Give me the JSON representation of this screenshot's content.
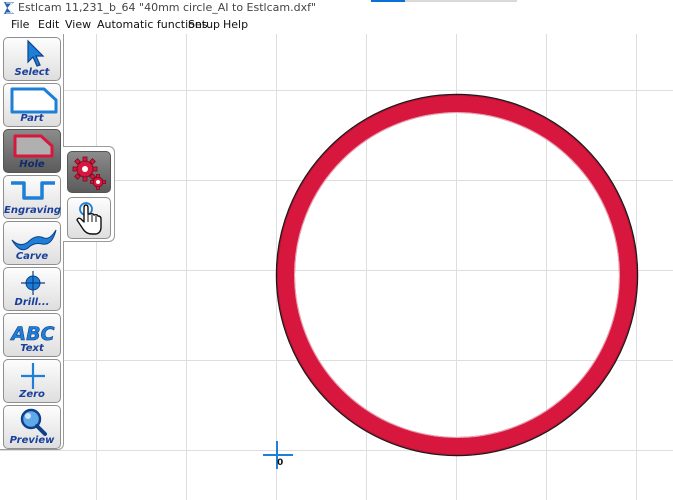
{
  "window": {
    "title": "Estlcam 11,231_b_64 \"40mm circle_AI to Estlcam.dxf\""
  },
  "menu": {
    "items": [
      "File",
      "Edit",
      "View",
      "Automatic functions",
      "Setup",
      "Help"
    ]
  },
  "toolbar": {
    "select": "Select",
    "part": "Part",
    "hole": "Hole",
    "engraving": "Engraving",
    "carve": "Carve",
    "drill": "Drill...",
    "text": "Text",
    "zero": "Zero",
    "preview": "Preview",
    "active_tool": "hole"
  },
  "subpanel": {
    "icons": [
      "gears-icon",
      "hand-pointer-icon"
    ]
  },
  "canvas": {
    "origin_label": "0",
    "shape": "circle",
    "shape_stroke": "#d7173e"
  },
  "colors": {
    "toolbar_label": "#1a3f9a",
    "grid": "#dedede",
    "path_red": "#d7173e",
    "accent_blue": "#1e7fd6"
  }
}
